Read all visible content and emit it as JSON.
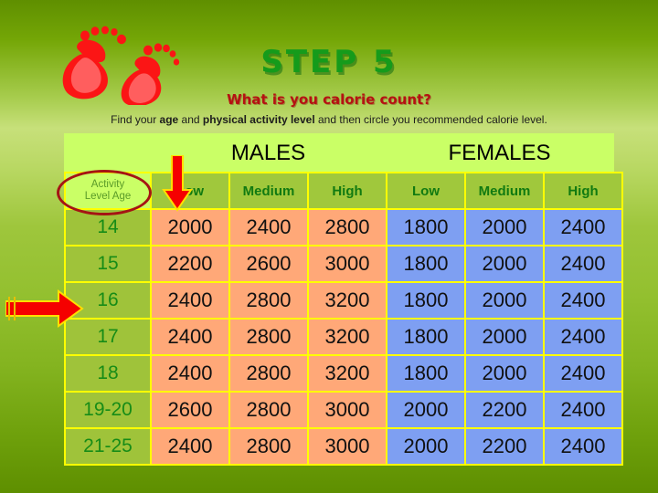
{
  "slide": {
    "step_title": "STEP 5",
    "subtitle": "What is you calorie count?",
    "instruction_prefix": "Find your ",
    "instruction_bold1": "age",
    "instruction_mid": " and ",
    "instruction_bold2": "physical activity level",
    "instruction_suffix": " and then circle you recommended calorie level.",
    "colors": {
      "title_green": "#159b1b",
      "subtitle_red": "#b51212",
      "band_bg": "#caff66",
      "grid_yellow": "#ffff00",
      "header_green": "#a0c83c",
      "age_green": "#9fc33a",
      "male_orange": "#ffa878",
      "female_blue": "#7e9ff2",
      "annotation_red": "#ee0000",
      "circle_red": "#a51414"
    }
  },
  "table": {
    "corner_label_line1": "Activity",
    "corner_label_line2": "Level Age",
    "gender_groups": [
      {
        "label": "MALES"
      },
      {
        "label": "FEMALES"
      }
    ],
    "activity_headers": [
      "Low",
      "Medium",
      "High",
      "Low",
      "Medium",
      "High"
    ],
    "rows": [
      {
        "age": "14",
        "values": [
          "2000",
          "2400",
          "2800",
          "1800",
          "2000",
          "2400"
        ]
      },
      {
        "age": "15",
        "values": [
          "2200",
          "2600",
          "3000",
          "1800",
          "2000",
          "2400"
        ]
      },
      {
        "age": "16",
        "values": [
          "2400",
          "2800",
          "3200",
          "1800",
          "2000",
          "2400"
        ]
      },
      {
        "age": "17",
        "values": [
          "2400",
          "2800",
          "3200",
          "1800",
          "2000",
          "2400"
        ]
      },
      {
        "age": "18",
        "values": [
          "2400",
          "2800",
          "3200",
          "1800",
          "2000",
          "2400"
        ]
      },
      {
        "age": "19-20",
        "values": [
          "2600",
          "2800",
          "3000",
          "2000",
          "2200",
          "2400"
        ]
      },
      {
        "age": "21-25",
        "values": [
          "2400",
          "2800",
          "3000",
          "2000",
          "2200",
          "2400"
        ]
      }
    ]
  },
  "annotations": {
    "circle_target": "Activity Level Age",
    "down_arrow_target": "Low",
    "right_arrow_target": "16"
  }
}
